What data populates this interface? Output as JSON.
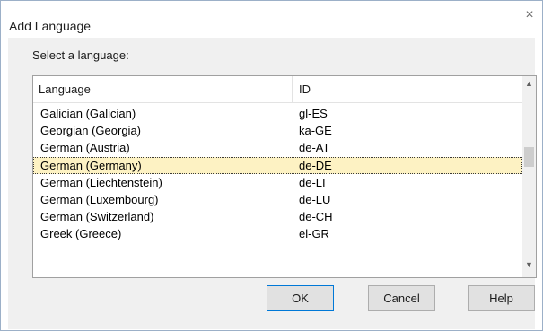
{
  "dialog": {
    "title": "Add Language",
    "close_glyph": "×",
    "prompt": "Select a language:"
  },
  "list": {
    "columns": [
      "Language",
      "ID"
    ],
    "rows": [
      {
        "language": "Galician (Galician)",
        "id": "gl-ES"
      },
      {
        "language": "Georgian (Georgia)",
        "id": "ka-GE"
      },
      {
        "language": "German (Austria)",
        "id": "de-AT"
      },
      {
        "language": "German (Germany)",
        "id": "de-DE"
      },
      {
        "language": "German (Liechtenstein)",
        "id": "de-LI"
      },
      {
        "language": "German (Luxembourg)",
        "id": "de-LU"
      },
      {
        "language": "German (Switzerland)",
        "id": "de-CH"
      },
      {
        "language": "Greek (Greece)",
        "id": "el-GR"
      }
    ],
    "selected_index": 3
  },
  "scrollbar": {
    "up_glyph": "▲",
    "down_glyph": "▼"
  },
  "buttons": {
    "ok": "OK",
    "cancel": "Cancel",
    "help": "Help"
  },
  "colors": {
    "selection_bg": "#fdf2c3",
    "default_button_border": "#0078d7"
  }
}
